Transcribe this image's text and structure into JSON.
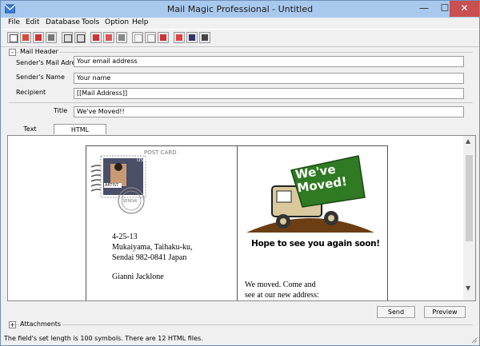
{
  "window": {
    "title": "Mail Magic Professional - Untitled",
    "minimize": "—",
    "maximize": "☐",
    "close": "✕"
  },
  "menu": [
    "File",
    "Edit",
    "Database",
    "Tools",
    "Option",
    "Help"
  ],
  "toolbar": {
    "icons": [
      "new-icon",
      "open-icon",
      "save-icon",
      "save-as-icon",
      "send-mail-icon",
      "receive-mail-icon",
      "cut-icon",
      "copy-icon",
      "paste-icon",
      "list-icon",
      "grid-icon",
      "delete-icon",
      "align-icon",
      "tree-icon",
      "export-icon"
    ]
  },
  "mail_header": {
    "group_label": "Mail Header",
    "collapse": "-",
    "sender_mail_label": "Sender's Mail Adress",
    "sender_mail_value": "Your email address",
    "sender_name_label": "Sender's Name",
    "sender_name_value": "Your name",
    "recipient_label": "Recipient",
    "recipient_value": "[[Mail Address]]"
  },
  "title_field": {
    "label": "Title",
    "value": "We've Moved!!"
  },
  "tabs": [
    "Text",
    "HTML"
  ],
  "postcard": {
    "header": "POST CARD",
    "date": "4-25-13",
    "address1": "Mukaiyama, Taihaku-ku,",
    "address2": "Sendai 982-0841 Japan",
    "signature": "Gianni Jacklone",
    "banner": "We've Moved!",
    "tagline": "Hope to see you again soon!",
    "body1": "We moved. Come and",
    "body2": "see at our new address:",
    "stamp_text": "USA",
    "postmark": "SENDAI",
    "stamp_caption": "ARTIST"
  },
  "scroll": {
    "up": "▲",
    "down": "▼"
  },
  "buttons": {
    "send": "Send",
    "preview": "Preview"
  },
  "attachments": {
    "label": "Attachments",
    "expand": "+"
  },
  "status": "The field's set length is 100 symbols. There are 12 HTML files."
}
